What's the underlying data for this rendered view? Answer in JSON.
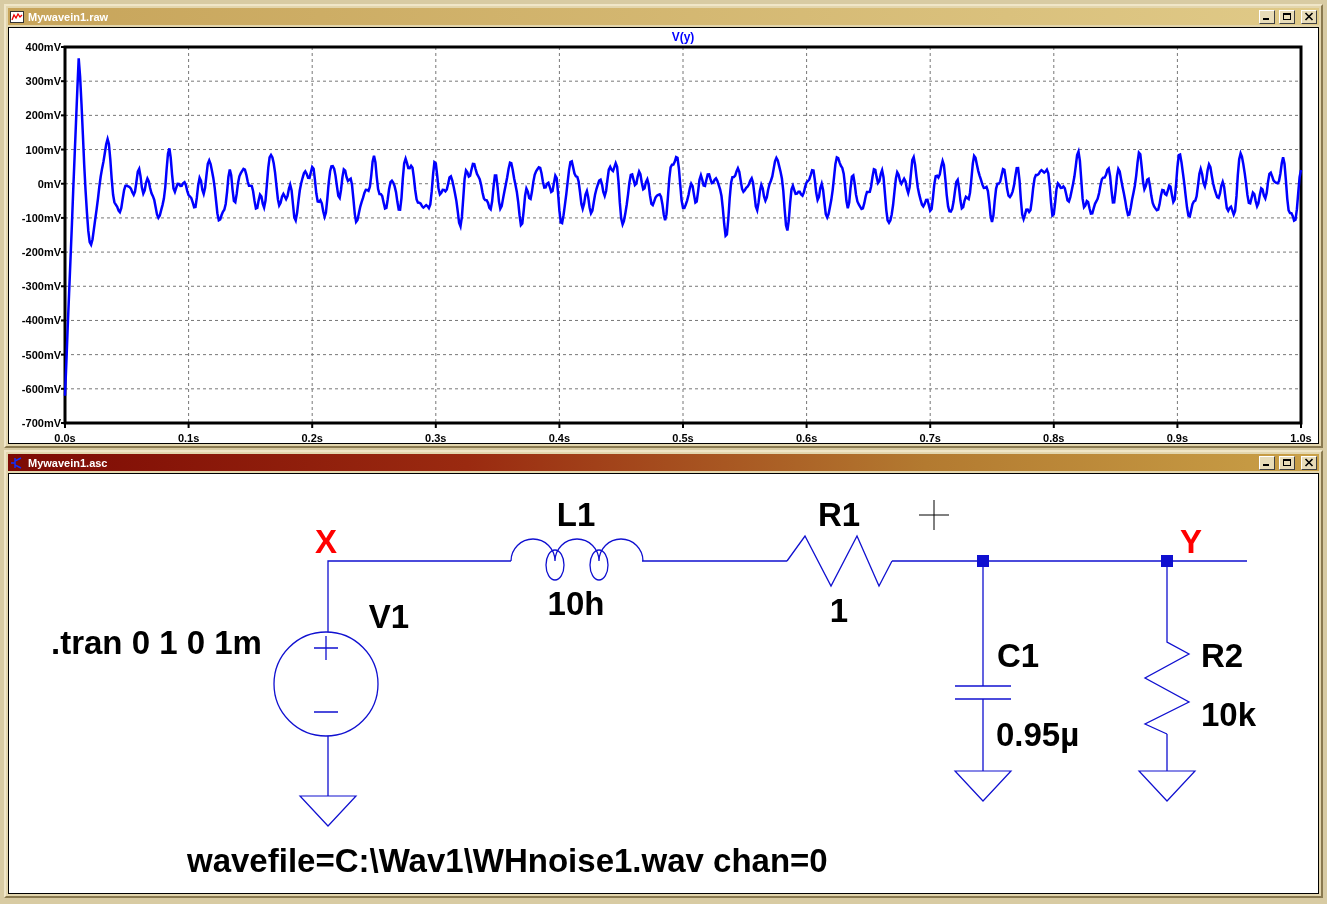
{
  "windows": [
    {
      "kind": "waveform",
      "title": "Mywavein1.raw",
      "active": false,
      "plot": {
        "trace": "V(y)",
        "y_ticks": [
          "400mV",
          "300mV",
          "200mV",
          "100mV",
          "0mV",
          "-100mV",
          "-200mV",
          "-300mV",
          "-400mV",
          "-500mV",
          "-600mV",
          "-700mV"
        ],
        "x_ticks": [
          "0.0s",
          "0.1s",
          "0.2s",
          "0.3s",
          "0.4s",
          "0.5s",
          "0.6s",
          "0.7s",
          "0.8s",
          "0.9s",
          "1.0s"
        ]
      }
    },
    {
      "kind": "schematic",
      "title": "Mywavein1.asc",
      "active": true,
      "schematic": {
        "nets": [
          {
            "label": "X"
          },
          {
            "label": "Y"
          }
        ],
        "components": [
          {
            "kind": "inductor",
            "name": "L1",
            "value": "10h"
          },
          {
            "kind": "resistor",
            "name": "R1",
            "value": "1"
          },
          {
            "kind": "voltage_source",
            "name": "V1",
            "value": "wavefile=C:\\Wav1\\WHnoise1.wav chan=0"
          },
          {
            "kind": "capacitor",
            "name": "C1",
            "value": "0.95µ"
          },
          {
            "kind": "resistor",
            "name": "R2",
            "value": "10k"
          }
        ],
        "directives": [
          ".tran 0 1 0 1m"
        ]
      }
    }
  ]
}
